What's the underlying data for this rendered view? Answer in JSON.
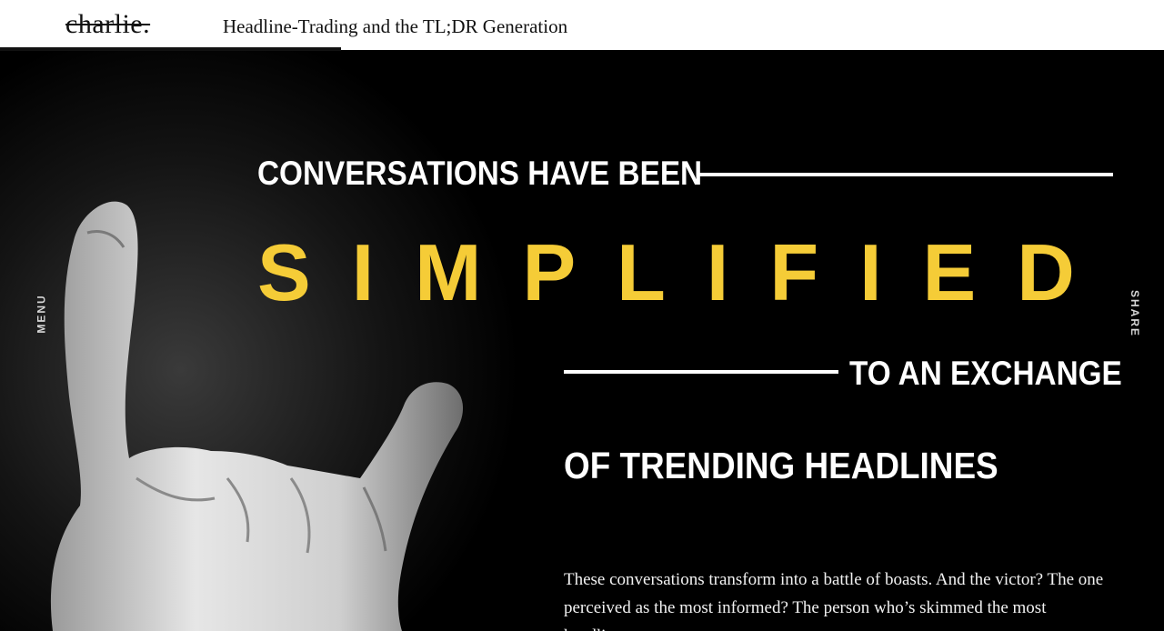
{
  "header": {
    "logo": "charlie.",
    "article_title": "Headline-Trading and the TL;DR Generation"
  },
  "side_nav": {
    "menu_label": "MENU",
    "share_label": "SHARE"
  },
  "hero": {
    "line1": "CONVERSATIONS HAVE BEEN",
    "highlight": "SIMPLIFIED",
    "line3": "TO AN EXCHANGE",
    "line4": "OF TRENDING HEADLINES",
    "body": "These conversations transform into a battle of boasts. And the victor? The one perceived as the most informed? The person who’s skimmed the most headlines."
  },
  "colors": {
    "accent": "#f5cc37",
    "background": "#000000",
    "header_bg": "#ffffff"
  }
}
